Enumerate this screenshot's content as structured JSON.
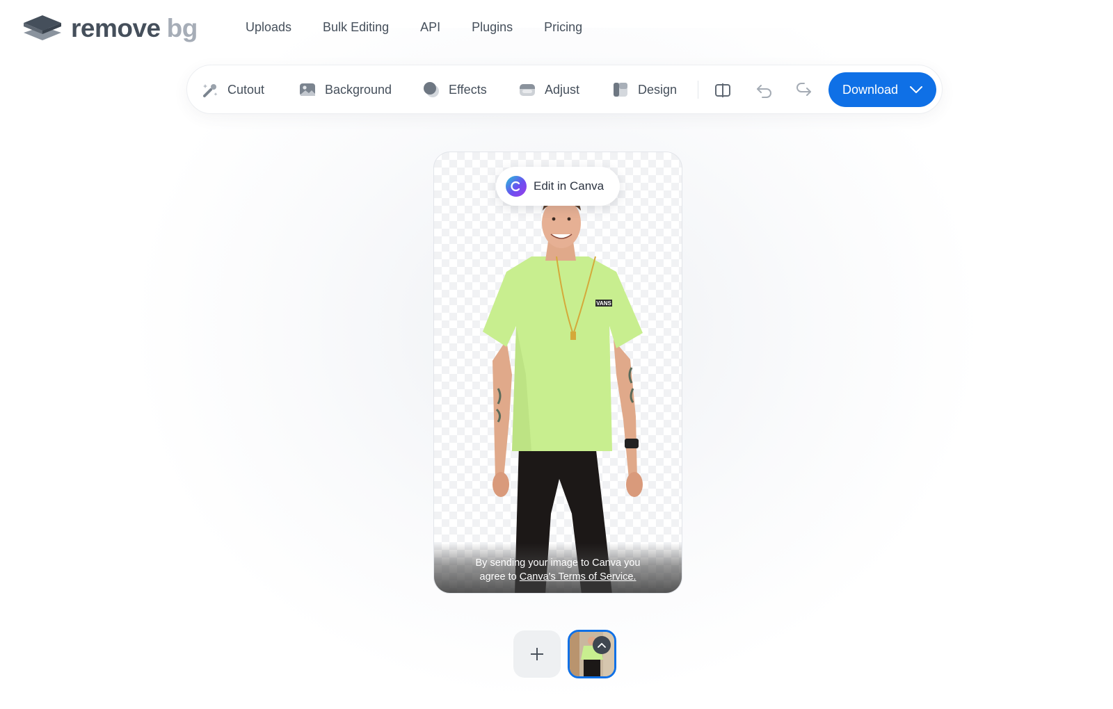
{
  "brand": {
    "name_part1": "remove",
    "name_part2": "bg"
  },
  "nav": {
    "items": [
      {
        "label": "Uploads"
      },
      {
        "label": "Bulk Editing"
      },
      {
        "label": "API"
      },
      {
        "label": "Plugins"
      },
      {
        "label": "Pricing"
      }
    ]
  },
  "toolbar": {
    "tools": [
      {
        "label": "Cutout",
        "icon": "magic-brush-icon"
      },
      {
        "label": "Background",
        "icon": "image-icon"
      },
      {
        "label": "Effects",
        "icon": "effects-icon"
      },
      {
        "label": "Adjust",
        "icon": "adjust-icon"
      },
      {
        "label": "Design",
        "icon": "design-icon"
      }
    ],
    "compare_icon": "compare-icon",
    "undo_icon": "undo-icon",
    "redo_icon": "redo-icon",
    "download_label": "Download",
    "accent_color": "#0f70e6"
  },
  "canvas": {
    "canva_button_label": "Edit in Canva",
    "consent_line1": "By sending your image to Canva you",
    "consent_line2_prefix": "agree to",
    "consent_link": "Canva's Terms of Service."
  },
  "shirt_badge": "VANS",
  "bottom": {
    "add_icon": "plus-icon",
    "thumb_toggle_icon": "chevron-up-icon"
  }
}
